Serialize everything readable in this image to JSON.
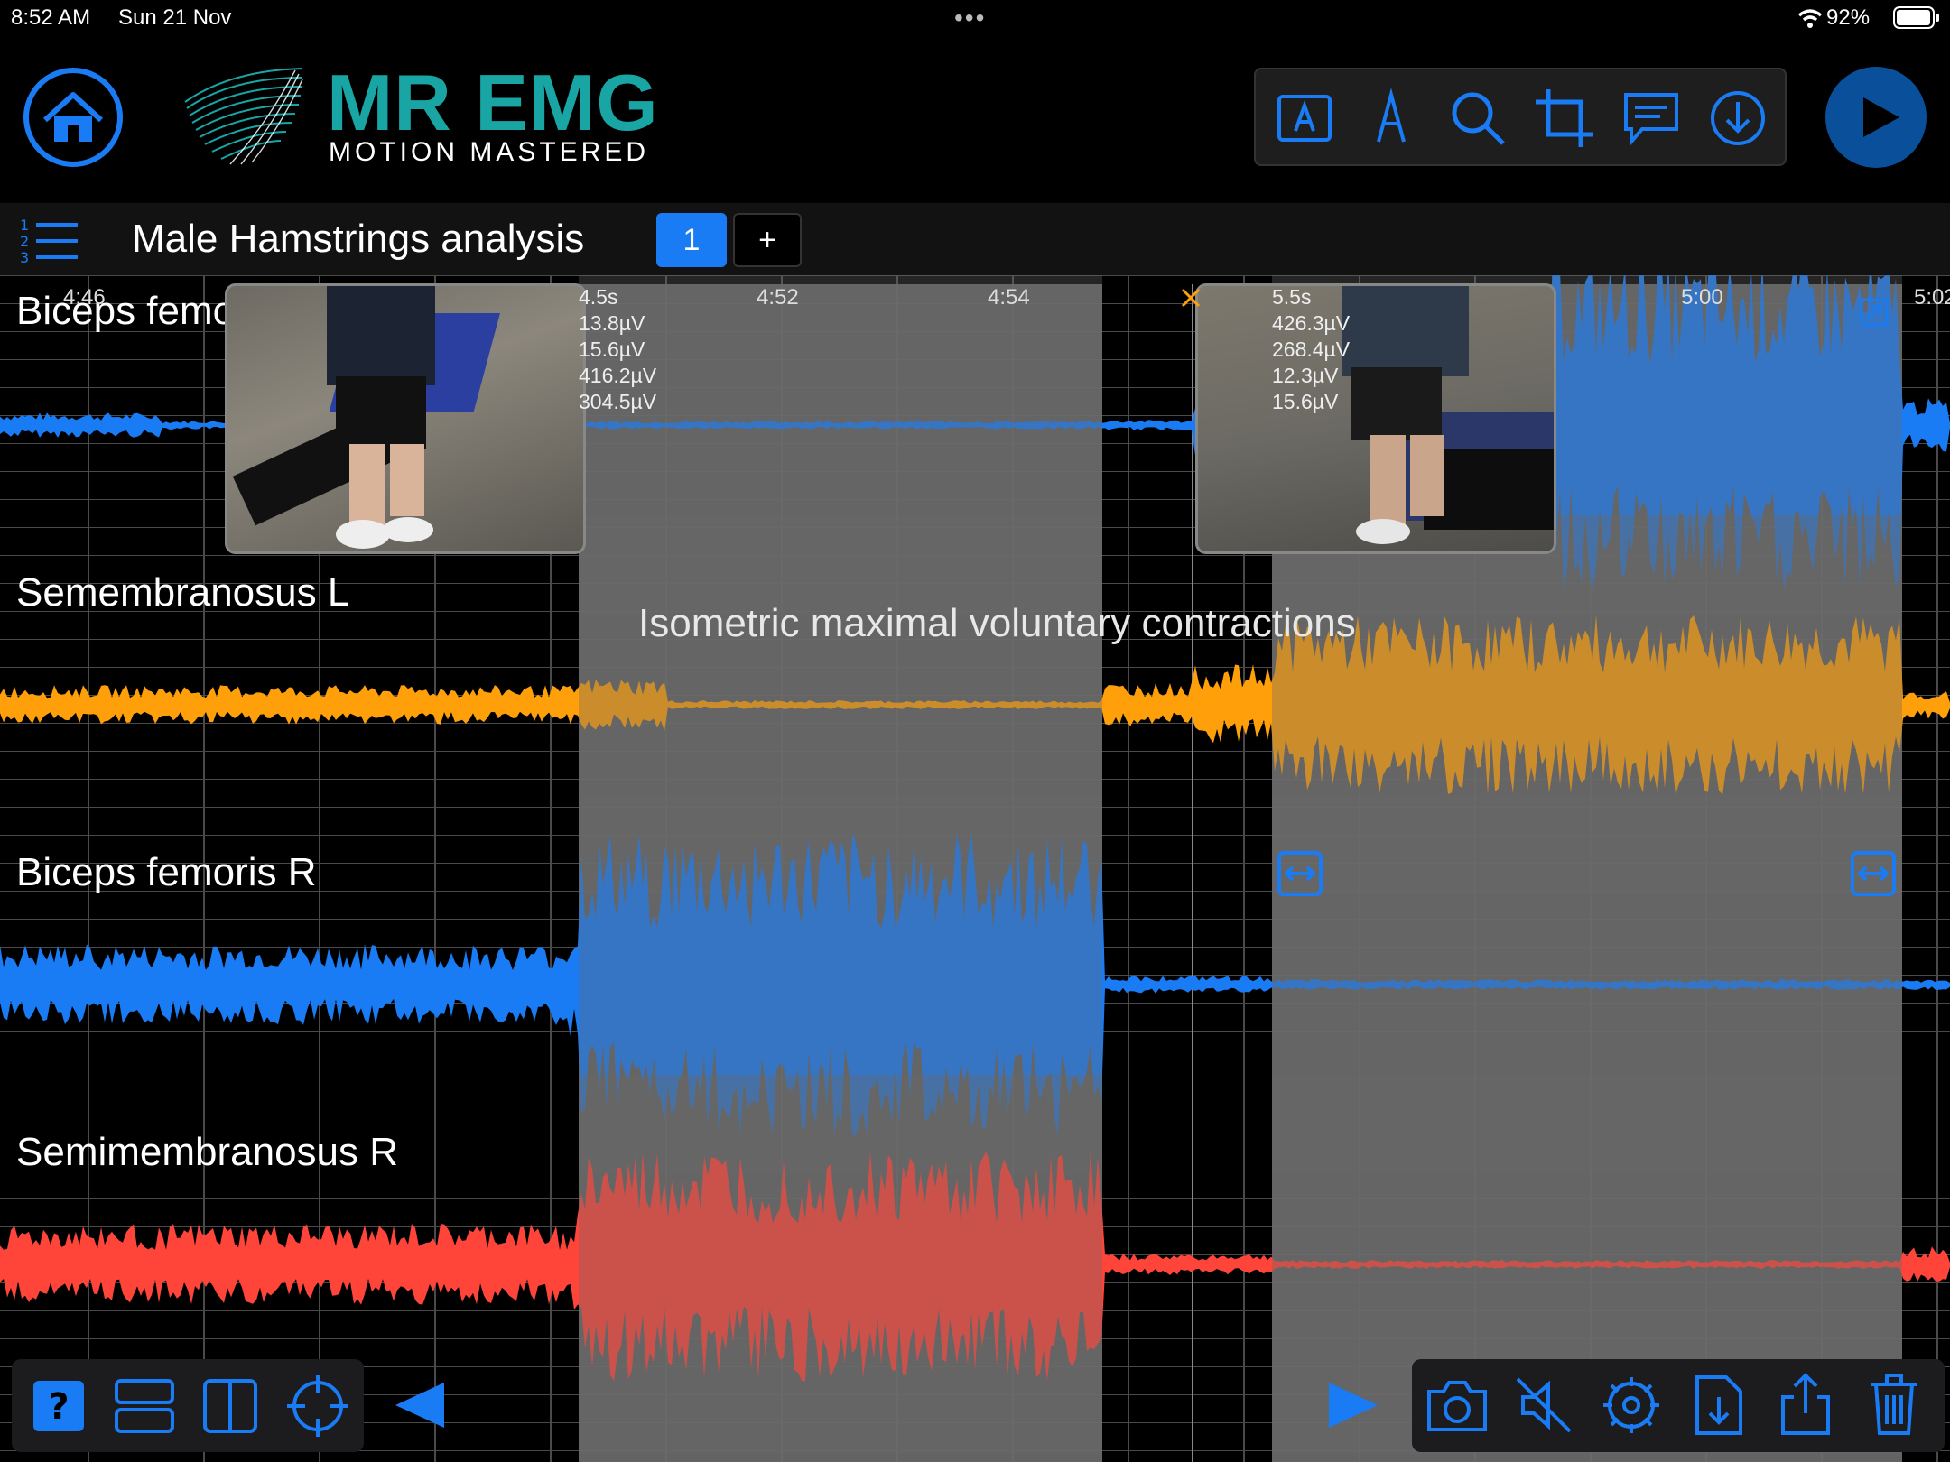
{
  "status": {
    "time": "8:52 AM",
    "date": "Sun 21 Nov",
    "battery": "92%"
  },
  "app": {
    "name": "MR EMG",
    "tagline": "MOTION MASTERED"
  },
  "session": {
    "title": "Male Hamstrings analysis",
    "page_tab": "1",
    "add_tab": "+"
  },
  "time_axis": [
    "4:46",
    "4:52",
    "4:54",
    "5:00",
    "5:02"
  ],
  "channels": [
    {
      "label": "Biceps femoris L",
      "color": "#1a7cf5"
    },
    {
      "label": "Semembranosus L",
      "color": "#ff9f0a"
    },
    {
      "label": "Biceps femoris R",
      "color": "#1a7cf5"
    },
    {
      "label": "Semimembranosus R",
      "color": "#ff453a"
    }
  ],
  "selection_1": {
    "duration": "4.5s",
    "values": [
      "13.8µV",
      "15.6µV",
      "416.2µV",
      "304.5µV"
    ]
  },
  "selection_2": {
    "duration": "5.5s",
    "values": [
      "426.3µV",
      "268.4µV",
      "12.3µV",
      "15.6µV"
    ]
  },
  "annotation": "Isometric maximal voluntary contractions",
  "icons": {
    "home": "home-icon",
    "text": "text-annotation-icon",
    "pen": "pen-icon",
    "search": "search-icon",
    "crop": "crop-icon",
    "comment": "comment-icon",
    "download": "download-icon",
    "play": "play-icon",
    "help": "help-icon",
    "stack": "stacked-layout-icon",
    "split": "split-layout-icon",
    "target": "crosshair-icon",
    "left": "previous-arrow-icon",
    "right": "next-arrow-icon",
    "camera": "camera-icon",
    "mute": "mute-icon",
    "settings": "gear-icon",
    "export": "export-file-icon",
    "share": "share-icon",
    "trash": "trash-icon"
  },
  "colors": {
    "accent": "#1a7cf5",
    "logo_teal": "#1aa5a5",
    "selection": "#6b6b6b"
  }
}
